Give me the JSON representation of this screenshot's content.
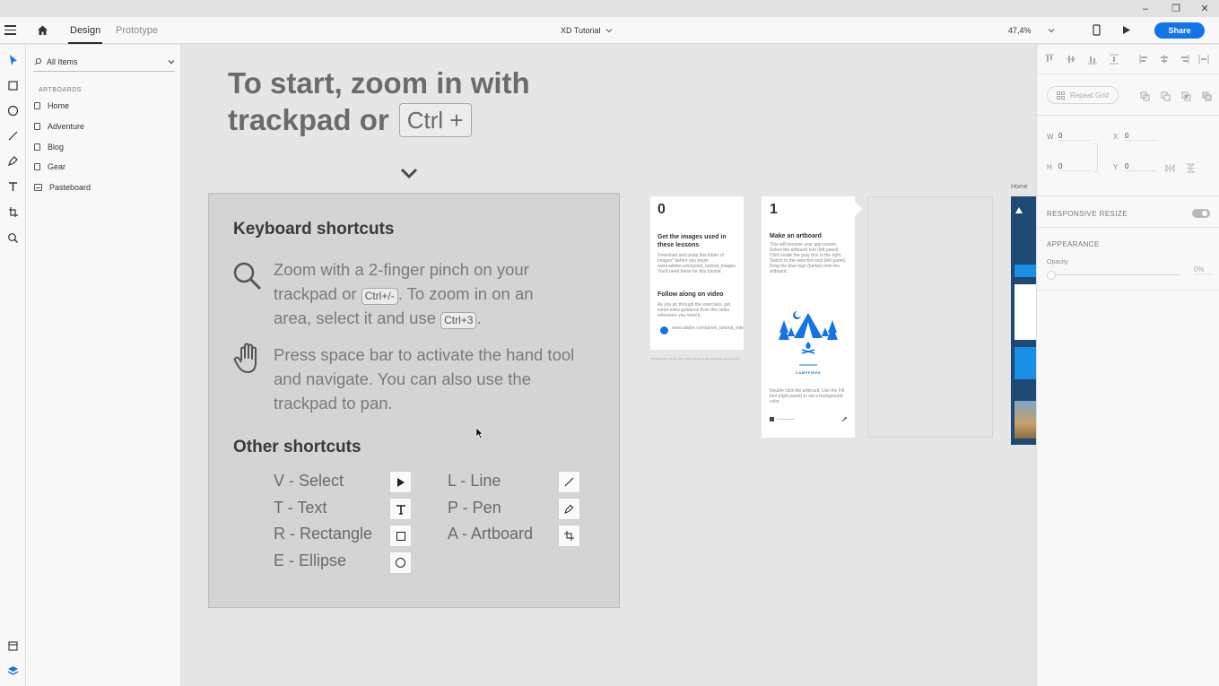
{
  "window": {
    "minimize_glyph": "–",
    "restore_glyph": "❐",
    "close_glyph": "✕"
  },
  "appbar": {
    "tabs": [
      {
        "label": "Design"
      },
      {
        "label": "Prototype"
      }
    ],
    "document_title": "XD Tutorial",
    "zoom": "47,4%",
    "share_label": "Share",
    "accent_color": "#1473e6"
  },
  "layers": {
    "filter_label": "All Items",
    "section_label": "ARTBOARDS",
    "items": [
      {
        "label": "Home"
      },
      {
        "label": "Adventure"
      },
      {
        "label": "Blog"
      },
      {
        "label": "Gear"
      },
      {
        "label": "Pasteboard"
      }
    ]
  },
  "canvas": {
    "intro": {
      "line1": "To start, zoom in with",
      "line2": "trackpad or",
      "key": "Ctrl +"
    },
    "card": {
      "heading": "Keyboard shortcuts",
      "zoom_text": {
        "a": "Zoom with a 2-finger pinch on your",
        "b": "trackpad or",
        "key1": "Ctrl+/-",
        "c": ". To zoom in on an",
        "d": "area, select it and use",
        "key2": "Ctrl+3",
        "e": "."
      },
      "pan_text": {
        "a": "Press space bar to activate the hand tool",
        "b": "and navigate. You can also use the",
        "c": "trackpad to pan."
      },
      "other_heading": "Other shortcuts",
      "shortcuts_left": [
        "V - Select",
        "T - Text",
        "R - Rectangle",
        "E - Ellipse"
      ],
      "shortcuts_right": [
        "L - Line",
        "P - Pen",
        "A - Artboard"
      ]
    },
    "step0": {
      "number": "0",
      "title": "Get the images used in these lessons",
      "body": "Download and unzip this folder of images* before you begin www.adobe.com/go/xd_tutorial_images You'll need these for this tutorial.",
      "subtitle": "Follow along on video",
      "body2": "As you go through the exercises, get some extra guidance from this video whenever you need it.",
      "link": "www.adobe.com/go/xd_tutorial_video",
      "footnote": "*Unsplash.com photos used under license for demonstration purposes only."
    },
    "step1": {
      "number": "1",
      "title": "Make an artboard",
      "body": "This will become your app screen. Select the artboard tool (left panel). Click inside the gray box to the right. Switch to the selection tool (left panel). Drag the blue logo (below) onto the artboard.",
      "logo_text": "CAMPFIRES",
      "body2": "Double click the artboard. Use the Fill tool (right panel) to set a background color."
    },
    "home_artboard_label": "Home"
  },
  "props": {
    "repeat_grid_label": "Repeat Grid",
    "w_label": "W",
    "w_value": "0",
    "x_label": "X",
    "x_value": "0",
    "h_label": "H",
    "h_value": "0",
    "y_label": "Y",
    "y_value": "0",
    "responsive_label": "RESPONSIVE RESIZE",
    "appearance_label": "APPEARANCE",
    "opacity_label": "Opacity",
    "opacity_value": "0%"
  }
}
